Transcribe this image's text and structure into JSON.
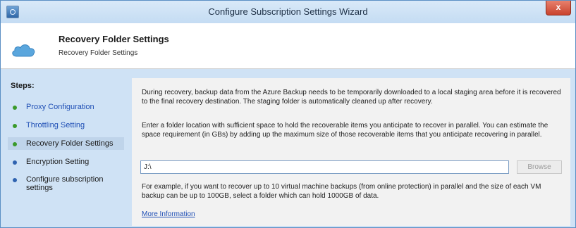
{
  "window": {
    "title": "Configure Subscription Settings Wizard",
    "close_label": "x"
  },
  "header": {
    "title": "Recovery Folder Settings",
    "subtitle": "Recovery Folder Settings"
  },
  "steps": {
    "title": "Steps:",
    "items": [
      {
        "label": "Proxy Configuration",
        "state": "done"
      },
      {
        "label": "Throttling Setting",
        "state": "done"
      },
      {
        "label": "Recovery Folder Settings",
        "state": "current"
      },
      {
        "label": "Encryption Setting",
        "state": "pending"
      },
      {
        "label": "Configure subscription settings",
        "state": "pending"
      }
    ]
  },
  "content": {
    "intro": "During recovery, backup data from the Azure Backup needs to be temporarily downloaded to a local staging area before it is recovered to the final recovery destination. The staging folder is automatically cleaned up after recovery.",
    "instructions": "Enter a folder location with sufficient space to hold the recoverable items you anticipate to recover in parallel. You can estimate the space requirement (in GBs) by adding up the maximum size of those recoverable items that you anticipate recovering in parallel.",
    "folder_value": "J:\\",
    "browse_label": "Browse",
    "example": "For example, if you want to recover up to 10 virtual machine backups (from online protection) in parallel and the size of each VM backup can be up to 100GB, select a folder which can hold 1000GB of data.",
    "more_info_label": "More Information"
  }
}
